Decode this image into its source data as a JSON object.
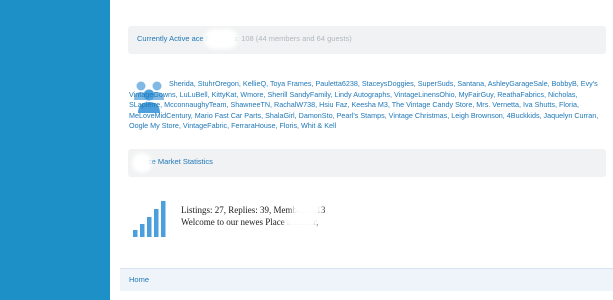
{
  "online_section": {
    "title": "Currently Active    ace Members",
    "count_text": ": 108 (44 members and 64 guests)"
  },
  "members": "Sherida, StuhrOregon, KellieQ, Toya Frames, Pauletta6238, StaceysDoggies, SuperSuds, Santana, AshleyGarageSale, BobbyB, Evy's VintageGowns, LuLuBell, KittyKat, Wmore, Sherill SandyFamily, Lindy Autographs, VintageLinensOhio, MyFairGuy, ReathaFabrics, Nicholas, SLapierre, McconnaughyTeam, ShawneeTN, RachalW738, Hsiu Faz, Keesha M3, The Vintage Candy Store, Mrs. Vernetta, Iva Shutts, Floria, MeLoveMidCentury, Mario Fast Car Parts, ShalaGirl, DamonSto, Pearl's Stamps, Vintage Christmas, Leigh Brownson, 4Buckkids, Jaquelyn Curran, Oogle My Store, VintageFabric, FerraraHouse, Floris, Whit & Kell",
  "stats_section": {
    "title": "Place Market Statistics"
  },
  "stats": {
    "line1": "Listings: 27, Replies: 39, Members: 113",
    "line2": "Welcome to our newes         Place member,"
  },
  "footer": {
    "home_label": "Home"
  },
  "colors": {
    "left_band": "#1e90c8",
    "link": "#2078b8",
    "bar_bg": "#f1f2f3"
  },
  "icons": {
    "members": "members-group-icon",
    "stats": "statistics-bars-icon"
  }
}
